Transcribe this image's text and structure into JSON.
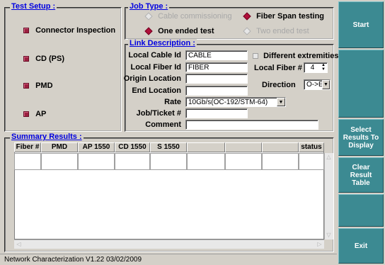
{
  "test_setup": {
    "title": "Test Setup :",
    "items": [
      {
        "label": "Connector Inspection"
      },
      {
        "label": "CD (PS)"
      },
      {
        "label": "PMD"
      },
      {
        "label": "AP"
      }
    ]
  },
  "job_type": {
    "title": "Job Type :",
    "options": [
      {
        "label": "Cable commissioning",
        "enabled": false
      },
      {
        "label": "Fiber Span testing",
        "enabled": true,
        "selected": true
      },
      {
        "label": "One ended test",
        "enabled": true,
        "selected": true
      },
      {
        "label": "Two ended test",
        "enabled": false
      }
    ]
  },
  "link": {
    "title": "Link Description :",
    "local_cable_id_label": "Local Cable Id",
    "local_cable_id": "CABLE",
    "local_fiber_id_label": "Local Fiber Id",
    "local_fiber_id": "FIBER",
    "origin_location_label": "Origin Location",
    "origin_location": "",
    "end_location_label": "End Location",
    "end_location": "",
    "rate_label": "Rate",
    "rate": "10Gb/s(OC-192/STM-64)",
    "job_ticket_label": "Job/Ticket #",
    "job_ticket": "",
    "comment_label": "Comment",
    "comment": "",
    "different_extremities_label": "Different extremities",
    "local_fiber_num_label": "Local Fiber #",
    "local_fiber_num": "4",
    "direction_label": "Direction",
    "direction": "O->E"
  },
  "summary": {
    "title": "Summary Results :",
    "columns": [
      "Fiber #",
      "PMD",
      "AP 1550",
      "CD 1550",
      "S 1550",
      "",
      "",
      "",
      "status"
    ]
  },
  "side_buttons": {
    "start": "Start",
    "select_results": "Select Results To Display",
    "clear_result": "Clear Result Table",
    "exit": "Exit"
  },
  "status_bar": {
    "text": "Network Characterization V1.22 03/02/2009"
  },
  "colors": {
    "background": "#d4d0c8",
    "side_button": "#3c8a92",
    "legend": "#0000e0",
    "indicator": "#9c2040"
  }
}
